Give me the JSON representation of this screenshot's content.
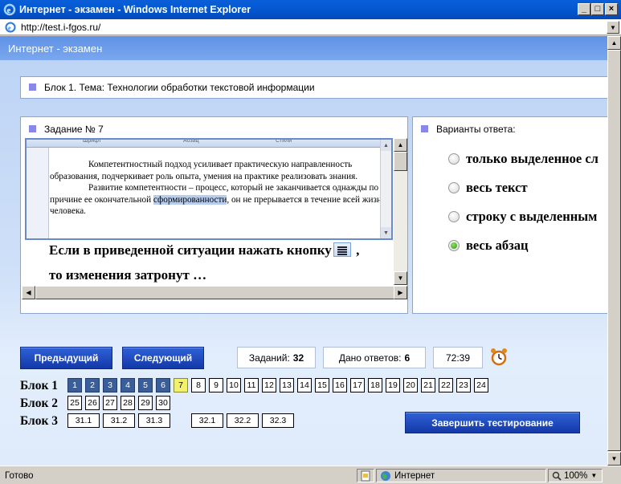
{
  "window": {
    "title": "Интернет - экзамен - Windows Internet Explorer",
    "controls": {
      "minimize": "_",
      "maximize": "□",
      "close": "×"
    }
  },
  "address_bar": {
    "url": "http://test.i-fgos.ru/"
  },
  "app": {
    "header": "Интернет - экзамен"
  },
  "block": {
    "title": "Блок 1. Тема: Технологии обработки текстовой информации"
  },
  "task": {
    "title": "Задание № 7",
    "ribbon_labels": [
      "Шрифт",
      "Абзац",
      "Стили"
    ],
    "doc_p1": "Компетентностный подход усиливает практическую направленность образования, подчеркивает роль опыта, умения на практике реализовать знания.",
    "doc_p2_a": "Развитие компетентности – процесс, который не заканчивается однажды по причине ее окончательной ",
    "doc_p2_hl": "сформированности",
    "doc_p2_b": ", он не прерывается в течение всей жизни человека.",
    "question_line1_a": "Если в приведенной ситуации нажать кнопку",
    "question_line1_b": ",",
    "question_line2": "то изменения затронут …"
  },
  "answers": {
    "title": "Варианты ответа:",
    "options": [
      {
        "label": "только выделенное сл",
        "selected": false
      },
      {
        "label": "весь текст",
        "selected": false
      },
      {
        "label": "строку с выделенным",
        "selected": false
      },
      {
        "label": "весь абзац",
        "selected": true
      }
    ]
  },
  "nav": {
    "prev_label": "Предыдущий",
    "next_label": "Следующий",
    "tasks_label": "Заданий:",
    "tasks_count": "32",
    "answered_label": "Дано ответов:",
    "answered_count": "6",
    "timer": "72:39",
    "finish_label": "Завершить тестирование"
  },
  "blocks": [
    {
      "label": "Блок 1",
      "cells": [
        "1",
        "2",
        "3",
        "4",
        "5",
        "6",
        "7",
        "8",
        "9",
        "10",
        "11",
        "12",
        "13",
        "14",
        "15",
        "16",
        "17",
        "18",
        "19",
        "20",
        "21",
        "22",
        "23",
        "24"
      ],
      "done": [
        "1",
        "2",
        "3",
        "4",
        "5",
        "6"
      ],
      "current": "7"
    },
    {
      "label": "Блок 2",
      "cells": [
        "25",
        "26",
        "27",
        "28",
        "29",
        "30"
      ],
      "done": [],
      "current": ""
    },
    {
      "label": "Блок 3",
      "cells": [
        "31.1",
        "31.2",
        "31.3",
        "32.1",
        "32.2",
        "32.3"
      ],
      "done": [],
      "current": ""
    }
  ],
  "status_bar": {
    "left": "Готово",
    "zone": "Интернет",
    "zoom": "100%"
  },
  "colors": {
    "done_cell": "#3a5e99",
    "current_cell": "#f3f06a",
    "button": "#1f4bbf",
    "header_band": "#6d9eea"
  }
}
